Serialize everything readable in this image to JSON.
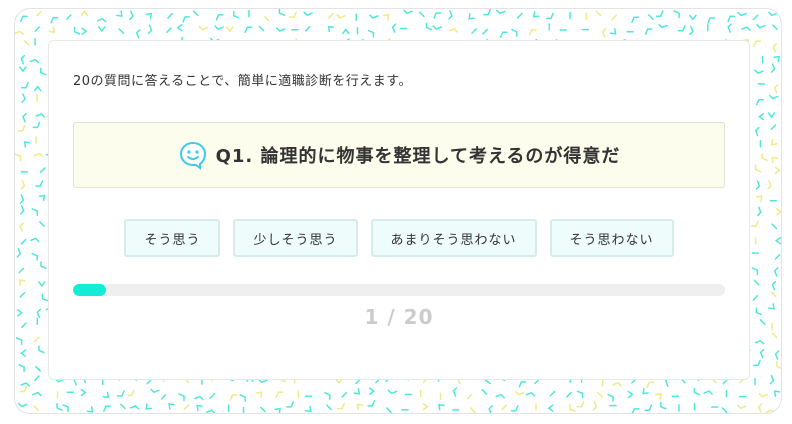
{
  "intro_text": "20の質問に答えることで、簡単に適職診断を行えます。",
  "question": {
    "icon": "smiley-speech-bubble-icon",
    "text": "Q1. 論理的に物事を整理して考えるのが得意だ"
  },
  "answers": [
    {
      "label": "そう思う"
    },
    {
      "label": "少しそう思う"
    },
    {
      "label": "あまりそう思わない"
    },
    {
      "label": "そう思わない"
    }
  ],
  "progress": {
    "current": 1,
    "total": 20,
    "label": "1 / 20",
    "fraction": 0.05
  },
  "colors": {
    "accent": "#14ecd5",
    "pattern_primary": "#4fe7db",
    "pattern_secondary": "#f1e98a",
    "question_bg": "#fcfdec",
    "answer_bg": "#eefcfc"
  }
}
